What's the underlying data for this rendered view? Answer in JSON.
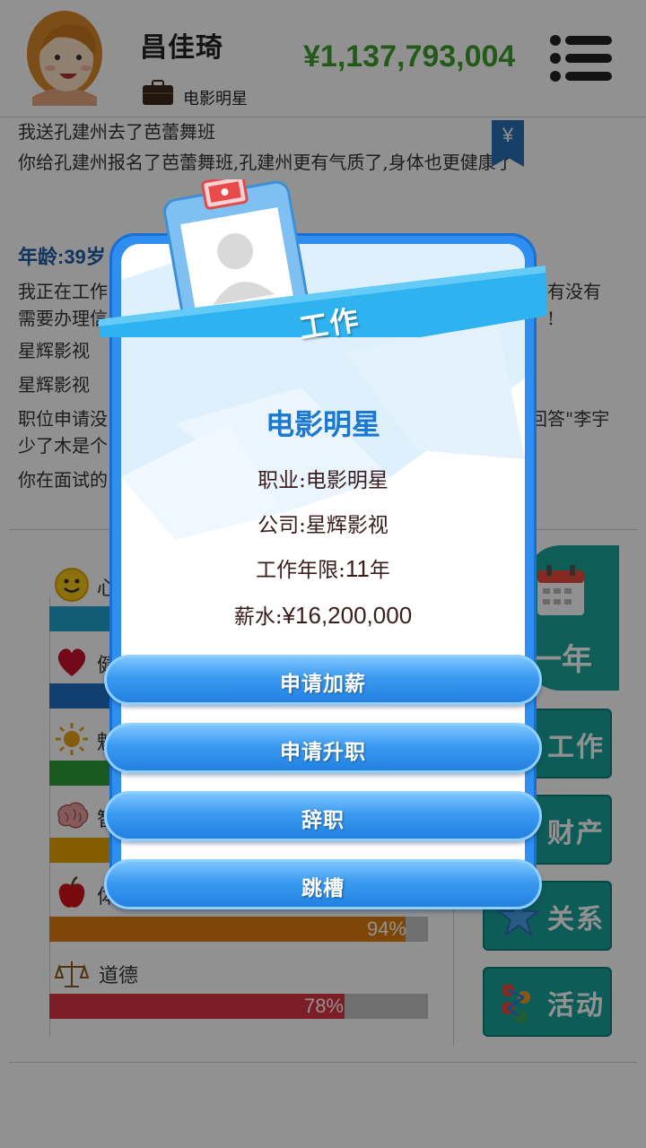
{
  "header": {
    "name": "昌佳琦",
    "job": "电影明星",
    "money": "¥1,137,793,004"
  },
  "log": {
    "lines": [
      "我送孔建州去了芭蕾舞班",
      "你给孔建州报名了芭蕾舞班,孔建州更有气质了,身体也更健康了"
    ],
    "age_heading": "年龄:39岁",
    "lines2": [
      "我正在工作",
      "需要办理信",
      "星辉影视",
      "星辉影视",
      "职位申请没",
      "少了木是个",
      "你在面试的"
    ],
    "right_fragments": [
      "我有没有",
      "!",
      "回答\"李宇"
    ],
    "yen_tag": "¥"
  },
  "stats": [
    {
      "label": "心",
      "percent": null,
      "color": "#1ea1cc",
      "icon": "smiley-icon"
    },
    {
      "label": "健",
      "percent": null,
      "color": "#1f6fc4",
      "icon": "heart-icon"
    },
    {
      "label": "魅",
      "percent": null,
      "color": "#2e9e3a",
      "icon": "sun-icon"
    },
    {
      "label": "智",
      "percent": null,
      "color": "#e8a400",
      "icon": "brain-icon"
    },
    {
      "label": "体",
      "percent": 94,
      "percent_text": "94%",
      "color": "#e07c12",
      "icon": "apple-icon"
    },
    {
      "label": "道德",
      "percent": 78,
      "percent_text": "78%",
      "color": "#dc3545",
      "icon": "scale-icon"
    }
  ],
  "side": {
    "next_year": "一年",
    "work": "工作",
    "property": "财产",
    "relations": "关系",
    "activities": "活动"
  },
  "modal": {
    "banner": "工作",
    "title": "电影明星",
    "occupation_label": "职业:",
    "occupation": "电影明星",
    "company_label": "公司:",
    "company": "星辉影视",
    "years_label": "工作年限:",
    "years_num": "11",
    "years_unit": "年",
    "salary_label": "薪水:",
    "salary": "¥16,200,000",
    "buttons": [
      "申请加薪",
      "申请升职",
      "辞职",
      "跳槽"
    ]
  }
}
